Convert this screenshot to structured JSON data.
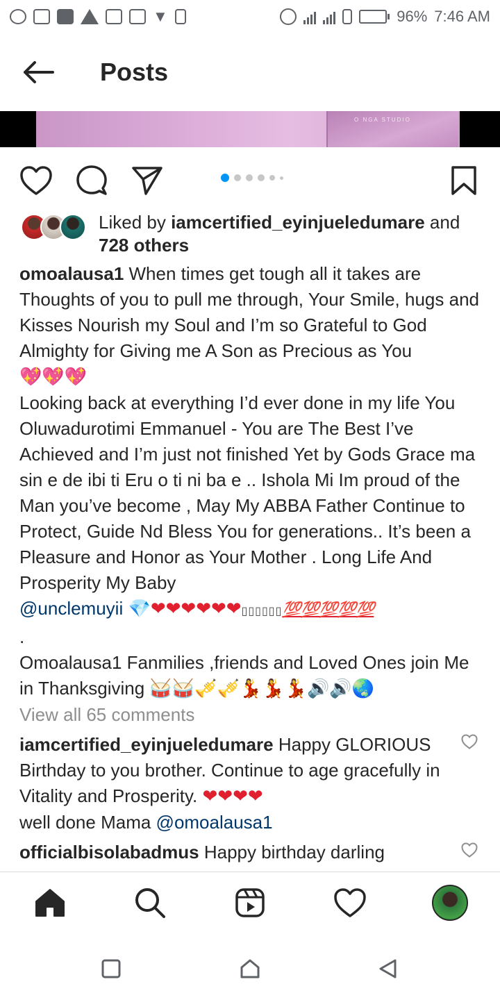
{
  "status_bar": {
    "battery": "96%",
    "time": "7:46 AM",
    "battery_level": 0.96,
    "left_icons": [
      "whatsapp-icon",
      "message-icon",
      "square-icon",
      "warning-icon",
      "gallery-icon",
      "image-icon",
      "twitter-icon",
      "sim-icon"
    ],
    "right_icons": [
      "data-saver-icon",
      "signal-icon",
      "signal-icon",
      "vibrate-icon",
      "battery-icon"
    ]
  },
  "header": {
    "title": "Posts",
    "back_icon": "arrow-left-icon"
  },
  "post": {
    "image_watermark": "O NGA STUDIO",
    "carousel_total": 6,
    "carousel_active": 0,
    "likes": {
      "prefix": "Liked by ",
      "user": "iamcertified_eyinjueledumare",
      "middle": " and",
      "others": "728 others"
    },
    "caption": {
      "user": "omoalausa1",
      "line1": " When times get tough all it takes are Thoughts of you to pull me through, Your Smile, hugs and Kisses Nourish my Soul and I’m so Grateful to God Almighty for Giving me A Son as Precious as You",
      "emoji1": "💖💖💖",
      "para2": "Looking back at everything I’d ever done in my life You Oluwadurotimi  Emmanuel - You are The Best I’ve Achieved  and I’m just not finished Yet by Gods Grace ma sin e de ibi ti Eru o ti ni ba e .. Ishola Mi Im proud of the Man you’ve become , May My ABBA Father Continue to Protect, Guide Nd Bless You for generations.. It’s been a Pleasure and Honor as Your Mother . Long Life And Prosperity My Baby",
      "mention": "@unclemuyii",
      "emoji2_diamond": "💎",
      "emoji2_hearts": "❤❤❤❤❤❤",
      "emoji2_boxes": "▯▯▯▯▯▯",
      "emoji2_hundreds": "💯💯💯💯💯",
      "dot": ".",
      "para3": "Omoalausa1 Fanmilies ,friends and Loved Ones join Me in Thanksgiving",
      "emoji3": "🥁🥁🎺🎺💃💃💃🔊🔊🌏"
    },
    "view_all": "View all 65 comments",
    "comments": [
      {
        "user": "iamcertified_eyinjueledumare",
        "text": " Happy GLORIOUS Birthday to you brother. Continue to age gracefully in Vitality and Prosperity. ",
        "hearts": "❤❤❤❤",
        "text2": "well done Mama ",
        "mention": "@omoalausa1"
      },
      {
        "user": "officialbisolabadmus",
        "text": " Happy birthday darling"
      }
    ]
  },
  "bottom_nav": [
    "home-icon",
    "search-icon",
    "reels-icon",
    "activity-icon",
    "profile-avatar"
  ],
  "system_nav": [
    "recents-icon",
    "home-icon",
    "back-icon"
  ],
  "colors": {
    "text": "#262626",
    "mention": "#00376b",
    "muted": "#8e8e8e",
    "accent_blue": "#0095f6",
    "heart_red": "#e0202f"
  }
}
